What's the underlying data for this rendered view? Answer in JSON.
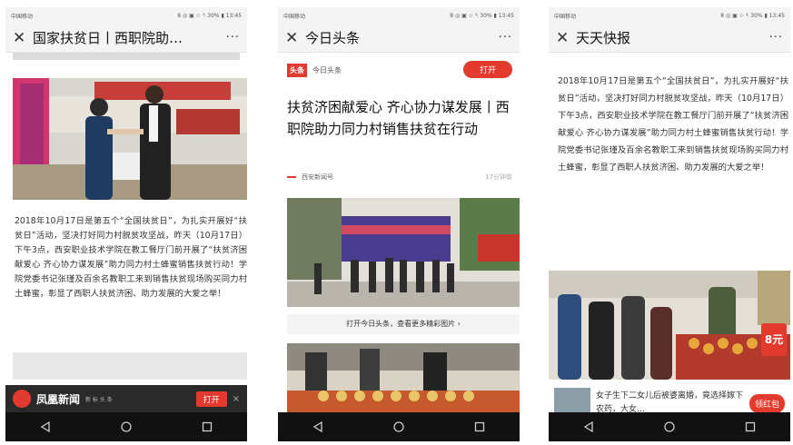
{
  "status_bar": {
    "carrier": "中国移动",
    "indicators": "8 ◎ ▣ ☆ ⁴ₗ 30% ▮ 13:45"
  },
  "phones": [
    {
      "title": "国家扶贫日丨西职院助…",
      "article": "2018年10月17日是第五个“全国扶贫日”，为扎实开展好“扶贫日”活动，坚决打好同力村脱贫攻坚战，昨天（10月17日）下午3点，西安职业技术学院在教工餐厅门前开展了“扶贫济困献爱心 齐心协力谋发展”助力同力村土蜂蜜销售扶贫行动！学院党委书记张瑾及百余名教职工来到销售扶贫现场购买同力村土蜂蜜，彰显了西职人扶贫济困、助力发展的大爱之举！",
      "banner": {
        "app_name": "凤凰新闻",
        "slogan": "新 标 头 条",
        "open_label": "打开",
        "close": "×"
      }
    },
    {
      "title": "今日头条",
      "brand": {
        "logo": "头条",
        "name": "今日头条",
        "open_label": "打开"
      },
      "headline": "扶贫济困献爱心 齐心协力谋发展丨西职院助力同力村销售扶贫在行动",
      "source": {
        "name": "西安新闻号",
        "time": "17分钟前"
      },
      "photo_banner": "扶贫济困献爱心 齐心协力谋发展",
      "more_photos_label": "打开今日头条，查看更多精彩图片 ›"
    },
    {
      "title": "天天快报",
      "article": "2018年10月17日是第五个“全国扶贫日”，为扎实开展好“扶贫日”活动，坚决打好同力村脱贫攻坚战，昨天（10月17日）下午3点，西安职业技术学院在教工餐厅门前开展了“扶贫济困献爱心 齐心协力谋发展”助力同力村土蜂蜜销售扶贫行动！学院党委书记张瑾及百余名教职工来到销售扶贫现场购买同力村土蜂蜜，彰显了西职人扶贫济困、助力发展的大爱之举！",
      "badge": "8元",
      "ad": {
        "text": "女子生下二女儿后被婆离婚，竟选择嫁下农药，大女…",
        "button": "领红包"
      }
    }
  ],
  "colors": {
    "accent_red": "#e23b2e",
    "nav_bar": "#111111"
  }
}
